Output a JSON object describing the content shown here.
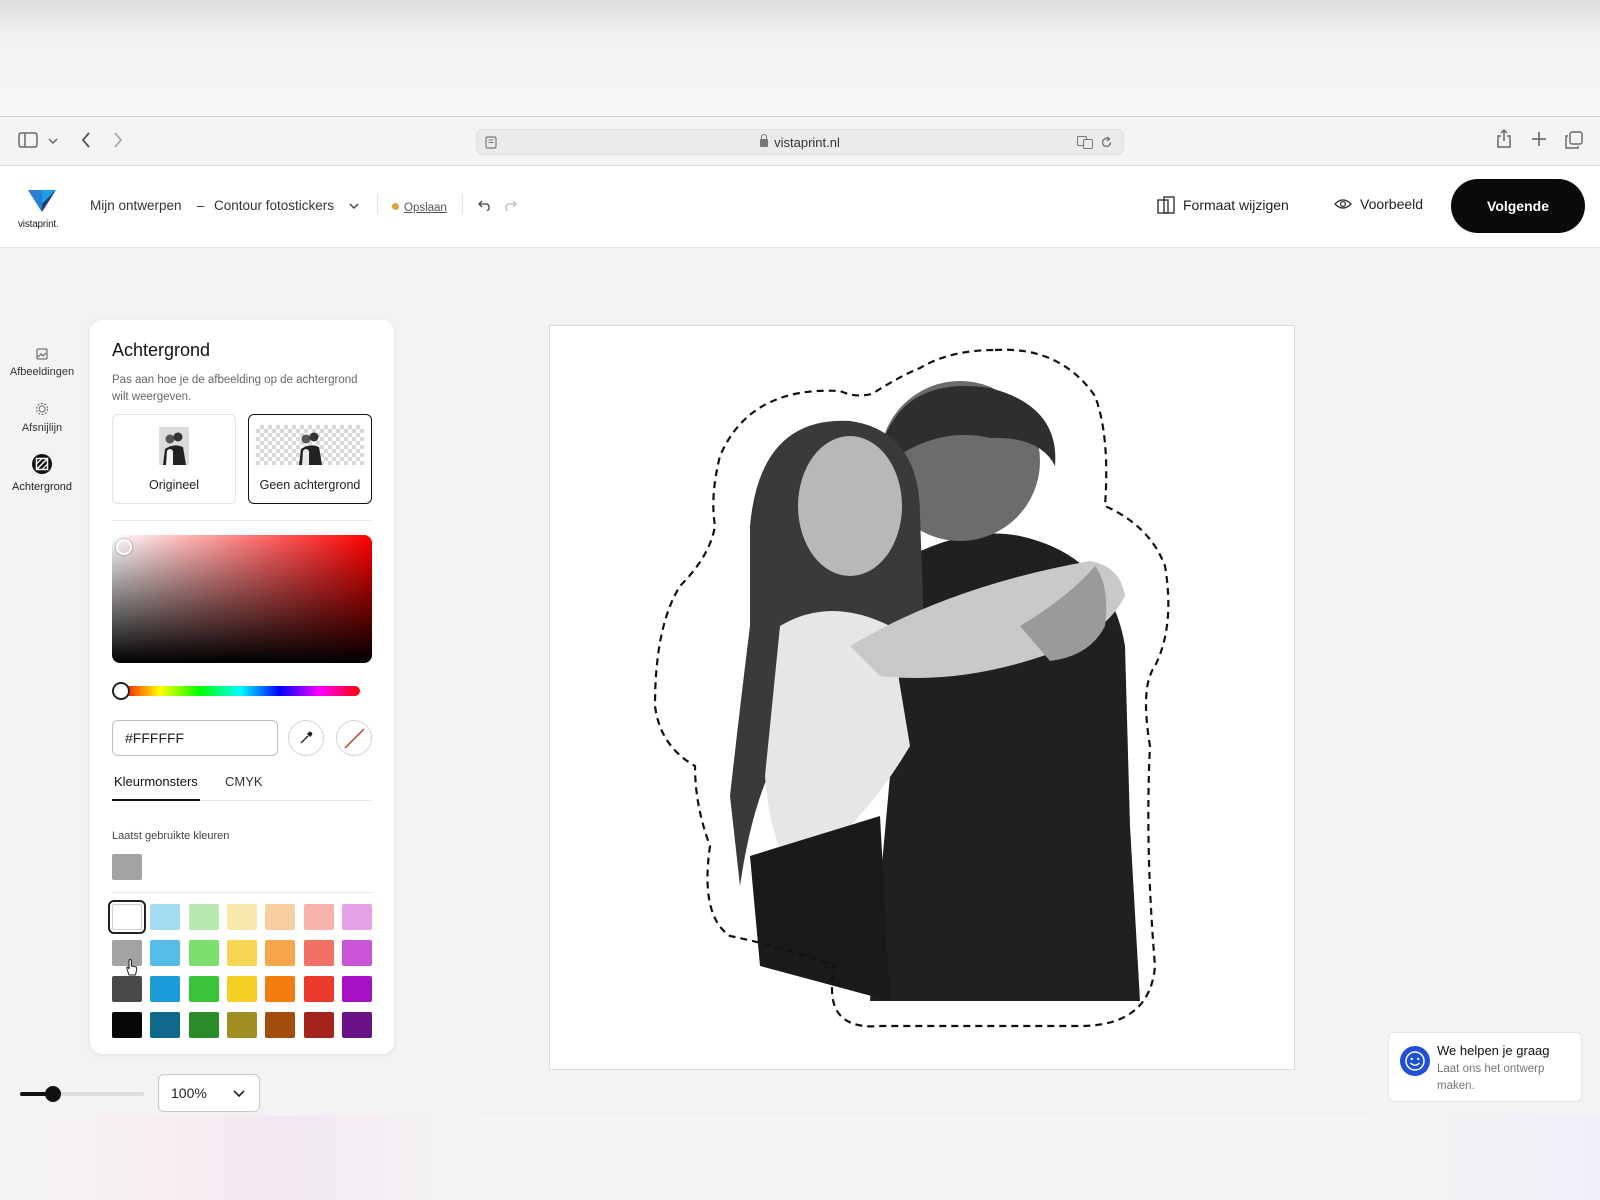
{
  "browser": {
    "url": "vistaprint.nl"
  },
  "header": {
    "logo_text": "vistaprint.",
    "breadcrumb_root": "Mijn ontwerpen",
    "breadcrumb_sep": "–",
    "product": "Contour fotostickers",
    "save_label": "Opslaan",
    "resize_label": "Formaat wijzigen",
    "preview_label": "Voorbeeld",
    "next_label": "Volgende"
  },
  "rail": {
    "items": [
      {
        "label": "Afbeeldingen",
        "icon": "image-icon"
      },
      {
        "label": "Afsnijlijn",
        "icon": "cut-line-icon"
      },
      {
        "label": "Achtergrond",
        "icon": "background-icon"
      }
    ]
  },
  "panel": {
    "title": "Achtergrond",
    "description": "Pas aan hoe je de afbeelding op de achtergrond wilt weergeven.",
    "options": [
      {
        "label": "Origineel",
        "selected": false
      },
      {
        "label": "Geen achtergrond",
        "selected": true
      }
    ],
    "hex_value": "#FFFFFF",
    "tabs": [
      {
        "label": "Kleurmonsters",
        "active": true
      },
      {
        "label": "CMYK",
        "active": false
      }
    ],
    "recent_label": "Laatst gebruikte kleuren",
    "recent_colors": [
      "#a3a3a3"
    ],
    "swatches": [
      [
        "#ffffff",
        "#a6dcf2",
        "#b8e9b0",
        "#f8e8ab",
        "#f7cfa3",
        "#f6b2ad",
        "#e3a3e6"
      ],
      [
        "#a3a3a3",
        "#55bde6",
        "#7ddd6e",
        "#f6d552",
        "#f5a64a",
        "#f26f64",
        "#c855d6"
      ],
      [
        "#4a4a4a",
        "#1b9bd8",
        "#3cc53a",
        "#f2cf22",
        "#f17e0f",
        "#ec3b2c",
        "#a711c4"
      ],
      [
        "#080808",
        "#116a8c",
        "#2a8b2a",
        "#a08f23",
        "#a34e0d",
        "#a5241e",
        "#6a1385"
      ]
    ]
  },
  "zoom": {
    "value": "100%",
    "level": 0.27
  },
  "chat": {
    "title": "We helpen je graag",
    "subtitle": "Laat ons het ontwerp maken."
  },
  "colors": {
    "accent": "#0a0a0a",
    "save_dot": "#e0a43c",
    "chat_icon": "#1f4fd6"
  }
}
